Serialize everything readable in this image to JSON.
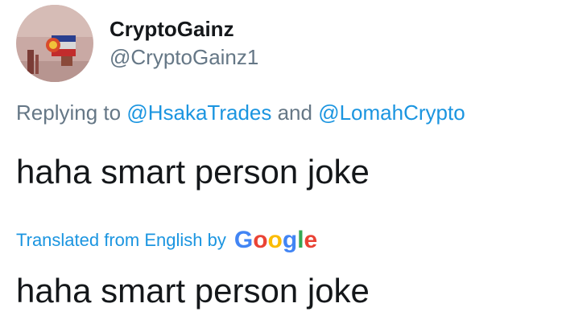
{
  "user": {
    "display_name": "CryptoGainz",
    "screen_name": "@CryptoGainz1"
  },
  "reply": {
    "prefix": "Replying to ",
    "mention_1": "@HsakaTrades",
    "connector": " and ",
    "mention_2": "@LomahCrypto"
  },
  "tweet": {
    "text": "haha smart person joke"
  },
  "translation": {
    "label": "Translated from English by",
    "provider_letters": [
      "G",
      "o",
      "o",
      "g",
      "l",
      "e"
    ],
    "text": "haha smart person joke"
  },
  "colors": {
    "text_primary": "#14171a",
    "text_secondary": "#657786",
    "link": "#1b95e0",
    "google_blue": "#4285f4",
    "google_red": "#ea4335",
    "google_yellow": "#fbbc05",
    "google_green": "#34a853"
  }
}
